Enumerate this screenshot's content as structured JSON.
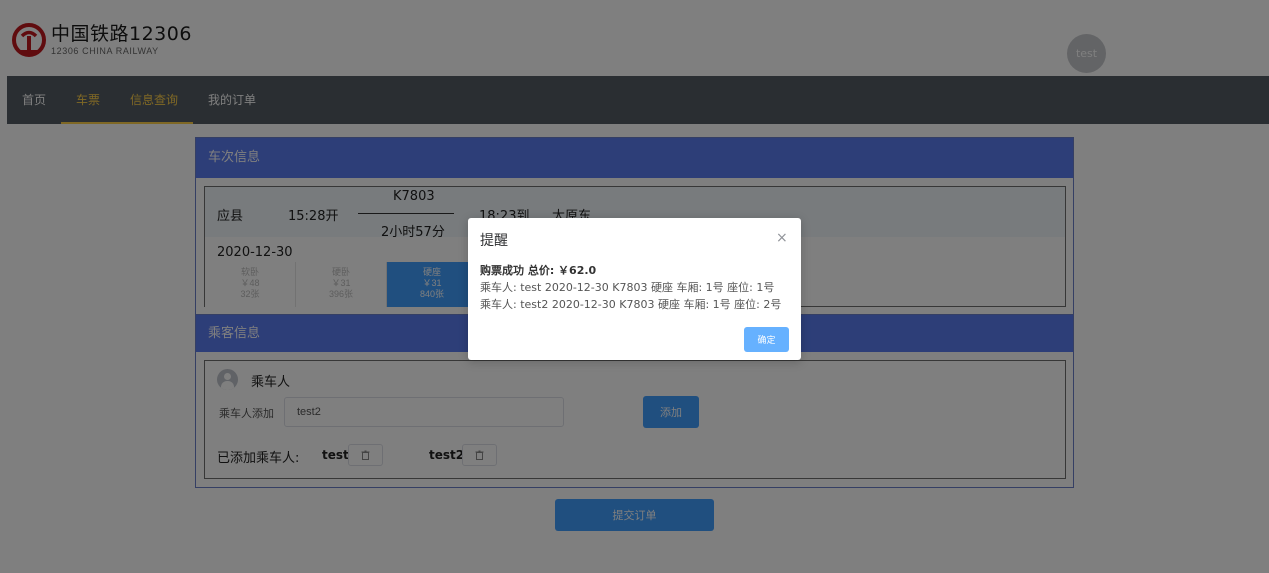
{
  "header": {
    "logo_title": "中国铁路12306",
    "logo_subtitle": "12306 CHINA RAILWAY",
    "user": "test"
  },
  "nav": {
    "items": [
      {
        "label": "首页",
        "active": false
      },
      {
        "label": "车票",
        "active": true
      },
      {
        "label": "信息查询",
        "active": true
      },
      {
        "label": "我的订单",
        "active": false
      }
    ]
  },
  "train_section": {
    "title": "车次信息",
    "from_station": "应县",
    "depart_time": "15:28开",
    "train_no": "K7803",
    "duration": "2小时57分",
    "arrive_time": "18:23到",
    "to_station": "太原东",
    "date": "2020-12-30",
    "seats": [
      {
        "type": "软卧",
        "price": "￥48",
        "remaining": "32张",
        "selected": false
      },
      {
        "type": "硬卧",
        "price": "￥31",
        "remaining": "396张",
        "selected": false
      },
      {
        "type": "硬座",
        "price": "￥31",
        "remaining": "840张",
        "selected": true
      }
    ]
  },
  "passenger_section": {
    "title": "乘客信息",
    "heading": "乘车人",
    "add_label": "乘车人添加",
    "input_value": "test2",
    "add_button": "添加",
    "added_label": "已添加乘车人:",
    "passengers": [
      "test",
      "test2"
    ]
  },
  "submit_button": "提交订单",
  "dialog": {
    "title": "提醒",
    "close": "×",
    "summary": "购票成功 总价: ￥62.0",
    "lines": [
      "乘车人: test 2020-12-30 K7803 硬座 车厢: 1号 座位: 1号",
      "乘车人: test2 2020-12-30 K7803 硬座 车厢: 1号 座位: 2号"
    ],
    "ok_button": "确定"
  },
  "colors": {
    "nav_bg": "#545c64",
    "nav_active": "#ffd04b",
    "section_head": "#5b7cf0",
    "primary": "#409eff",
    "logo_red": "#c0191f"
  }
}
